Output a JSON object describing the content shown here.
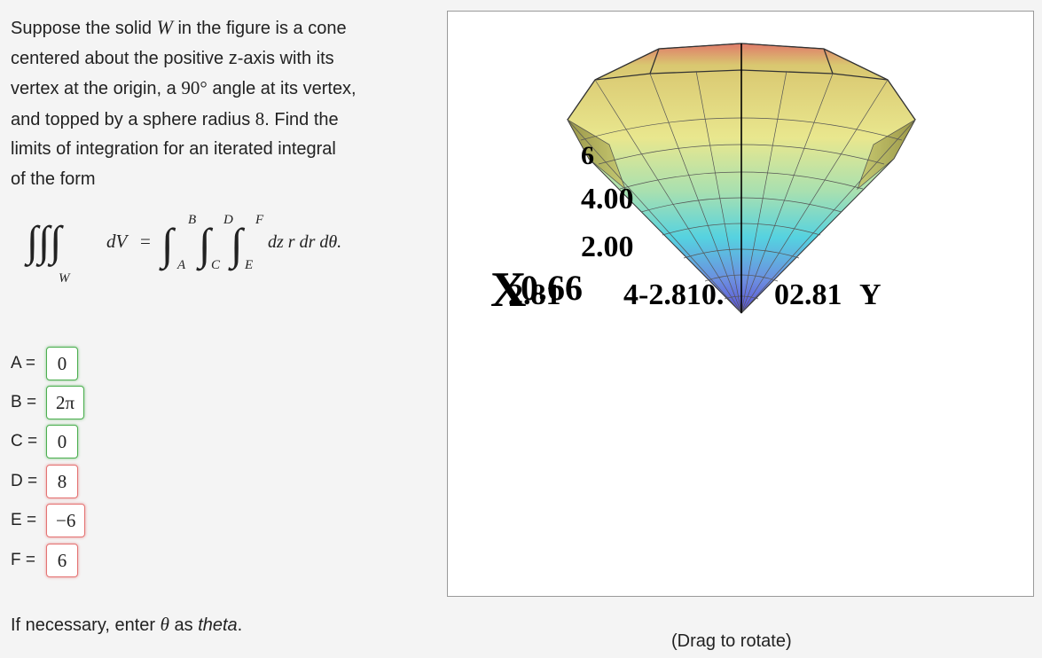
{
  "problem": {
    "line1_pre": "Suppose the solid",
    "solid_var": "W",
    "line1_post": "in the figure is a cone",
    "line2": "centered about the positive z-axis with its",
    "line3_pre": "vertex at the origin, a",
    "angle": "90°",
    "line3_post": "angle at its vertex,",
    "line4_pre": "and topped by a sphere radius",
    "radius": "8",
    "line4_post": ". Find the",
    "line5": "limits of integration for an iterated integral",
    "line6": "of the form"
  },
  "integral": {
    "region": "W",
    "lhs_differential": "dV",
    "equals": "=",
    "limits": {
      "B": "B",
      "A": "A",
      "D": "D",
      "C": "C",
      "F": "F",
      "E": "E"
    },
    "integrand": "dz r dr dθ."
  },
  "answers": [
    {
      "label": "A =",
      "value": "0",
      "status": "correct"
    },
    {
      "label": "B =",
      "value": "2π",
      "status": "correct"
    },
    {
      "label": "C =",
      "value": "0",
      "status": "correct"
    },
    {
      "label": "D =",
      "value": "8",
      "status": "incorrect"
    },
    {
      "label": "E =",
      "value": "−6",
      "status": "incorrect"
    },
    {
      "label": "F =",
      "value": "6",
      "status": "incorrect"
    }
  ],
  "note": {
    "pre": "If necessary, enter",
    "theta": "θ",
    "mid": "as",
    "word": "theta",
    "post": "."
  },
  "viewer": {
    "z_tick_top": "6",
    "z_tick_mid": "4.00",
    "z_tick_low": "2.00",
    "x_axis_label": "X",
    "x_ticks_overlap": "2.81",
    "x_ticks_overlap_2": "0.66",
    "y_ticks": "4-2.810.",
    "y_tick_right": "02.81",
    "y_axis_label": "Y",
    "hint": "(Drag to rotate)"
  },
  "colors": {
    "correct": "#4caf50",
    "incorrect": "#e57373",
    "cone_top": "#e07070",
    "cone_mid": "#e8e070",
    "cone_cyan": "#50d0e0",
    "cone_bottom": "#5050e0"
  }
}
